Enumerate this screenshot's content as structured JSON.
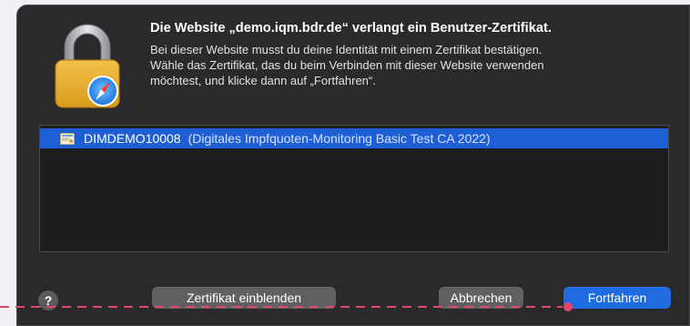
{
  "dialog": {
    "title": "Die Website „demo.iqm.bdr.de“ verlangt ein Benutzer-Zertifikat.",
    "description_lines": [
      "Bei dieser Website musst du deine Identität mit einem Zertifikat bestätigen.",
      "Wähle das Zertifikat, das du beim Verbinden mit dieser Website verwenden",
      "möchtest, und klicke dann auf „Fortfahren“."
    ],
    "icon": "lock-safari-icon"
  },
  "certificates": [
    {
      "name": "DIMDEMO10008",
      "issuer": "(Digitales Impfquoten-Monitoring Basic Test CA 2022)",
      "selected": true,
      "icon": "certificate-icon"
    }
  ],
  "buttons": {
    "help": "?",
    "show_certificate": "Zertifikat einblenden",
    "cancel": "Abbrechen",
    "continue": "Fortfahren"
  },
  "colors": {
    "dialog_bg": "#2a2a2c",
    "selection": "#1e5fd6",
    "primary_button": "#1f6ce0",
    "annotation": "#e8456b"
  }
}
